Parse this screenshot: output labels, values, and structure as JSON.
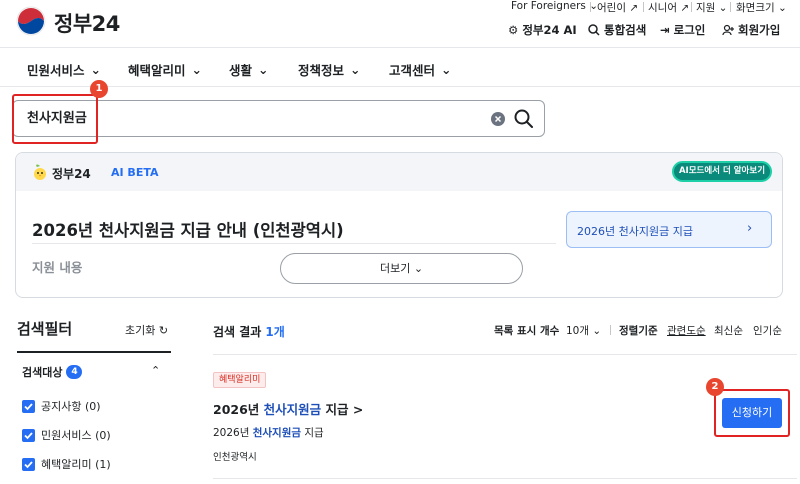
{
  "header": {
    "logo_text": "정부24",
    "util_links": [
      "For Foreigners",
      "어린이",
      "시니어",
      "지원",
      "화면크기"
    ],
    "tools": {
      "ai": "정부24 AI",
      "search": "통합검색",
      "login": "로그인",
      "signup": "회원가입"
    }
  },
  "nav": {
    "items": [
      "민원서비스",
      "혜택알리미",
      "생활",
      "정책정보",
      "고객센터"
    ]
  },
  "search": {
    "value": "천사지원금"
  },
  "annotations": {
    "step1": "1",
    "step2": "2"
  },
  "ai_panel": {
    "brand": "정부24",
    "beta": "AI BETA",
    "more_button": "AI모드에서 더 알아보기",
    "title": "2026년 천사지원금 지급 안내 (인천광역시)",
    "section_label": "지원 내용",
    "expand_button": "더보기",
    "related_link": "2026년 천사지원금 지급"
  },
  "filter": {
    "title": "검색필터",
    "reset": "초기화",
    "group_label": "검색대상",
    "group_count": "4",
    "options": [
      {
        "label": "공지사항 (0)",
        "checked": true
      },
      {
        "label": "민원서비스 (0)",
        "checked": true
      },
      {
        "label": "혜택알리미 (1)",
        "checked": true
      }
    ]
  },
  "results": {
    "label": "검색 결과",
    "count": "1개",
    "list_count_label": "목록 표시 개수",
    "list_count_value": "10개",
    "sort_label": "정렬기준",
    "sort_options": [
      "관련도순",
      "최신순",
      "인기순"
    ],
    "items": [
      {
        "tag": "혜택알리미",
        "title_prefix": "2026년 ",
        "title_highlight": "천사지원금",
        "title_suffix": " 지급",
        "title_arrow": ">",
        "desc_prefix": "2026년 ",
        "desc_highlight": "천사지원금",
        "desc_suffix": " 지급",
        "org": "인천광역시",
        "apply_button": "신청하기"
      }
    ]
  }
}
